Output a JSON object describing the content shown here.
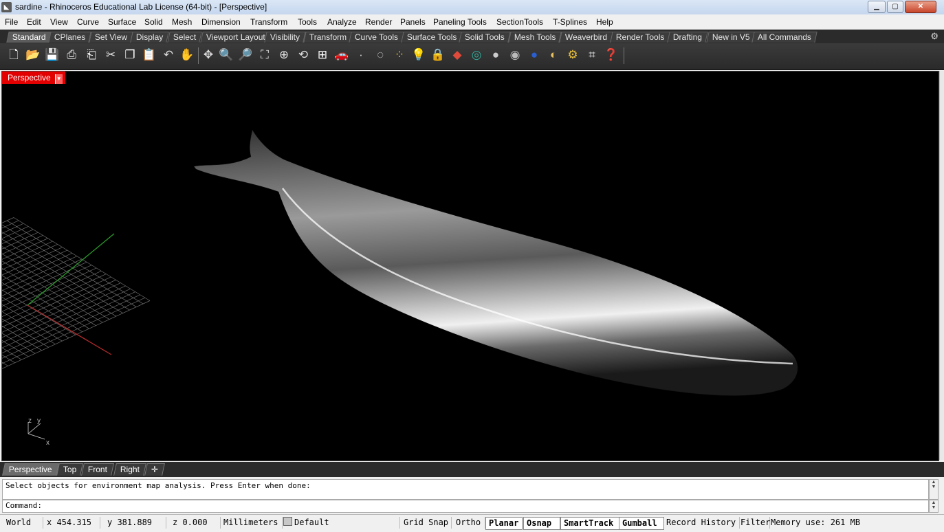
{
  "window": {
    "title": "sardine - Rhinoceros Educational Lab License (64-bit) - [Perspective]",
    "controls": [
      "minimize",
      "maximize",
      "close"
    ]
  },
  "menu": [
    "File",
    "Edit",
    "View",
    "Curve",
    "Surface",
    "Solid",
    "Mesh",
    "Dimension",
    "Transform",
    "Tools",
    "Analyze",
    "Render",
    "Panels",
    "Paneling Tools",
    "SectionTools",
    "T-Splines",
    "Help"
  ],
  "toolbar_tabs": [
    "Standard",
    "CPlanes",
    "Set View",
    "Display",
    "Select",
    "Viewport Layout",
    "Visibility",
    "Transform",
    "Curve Tools",
    "Surface Tools",
    "Solid Tools",
    "Mesh Tools",
    "Weaverbird",
    "Render Tools",
    "Drafting",
    "New in V5",
    "All Commands"
  ],
  "toolbar_icons": [
    "new-file",
    "open-file",
    "save",
    "print",
    "import",
    "copy",
    "paste",
    "undo",
    "pan",
    "move",
    "zoom",
    "zoom-window",
    "zoom-extents",
    "zoom-selected",
    "rotate-view",
    "four-viewports",
    "car",
    "point",
    "circle",
    "curve-points",
    "light-bulb",
    "lock",
    "layer",
    "color-wheel",
    "render-sphere",
    "render-sphere-2",
    "blue-sphere",
    "material",
    "settings",
    "snap",
    "help"
  ],
  "viewport": {
    "label": "Perspective",
    "axes": [
      "z",
      "y",
      "x"
    ],
    "colors": {
      "background": "#000000",
      "grid": "#6e6e6e",
      "x_axis": "#b02a2a",
      "y_axis": "#2a9a2a",
      "label": "#e20000"
    }
  },
  "viewport_tabs": [
    "Perspective",
    "Top",
    "Front",
    "Right"
  ],
  "command": {
    "history": "Select objects for environment map analysis. Press Enter when done:",
    "prompt": "Command:",
    "value": ""
  },
  "status": {
    "cplane": "World",
    "x": "x 454.315",
    "y": "y 381.889",
    "z": "z 0.000",
    "units": "Millimeters",
    "layer": "Default",
    "toggles": [
      {
        "label": "Grid Snap",
        "on": false
      },
      {
        "label": "Ortho",
        "on": false
      },
      {
        "label": "Planar",
        "on": true
      },
      {
        "label": "Osnap",
        "on": true
      },
      {
        "label": "SmartTrack",
        "on": true
      },
      {
        "label": "Gumball",
        "on": true
      },
      {
        "label": "Record History",
        "on": false
      },
      {
        "label": "Filter",
        "on": false
      }
    ],
    "memory": "Memory use: 261 MB"
  }
}
